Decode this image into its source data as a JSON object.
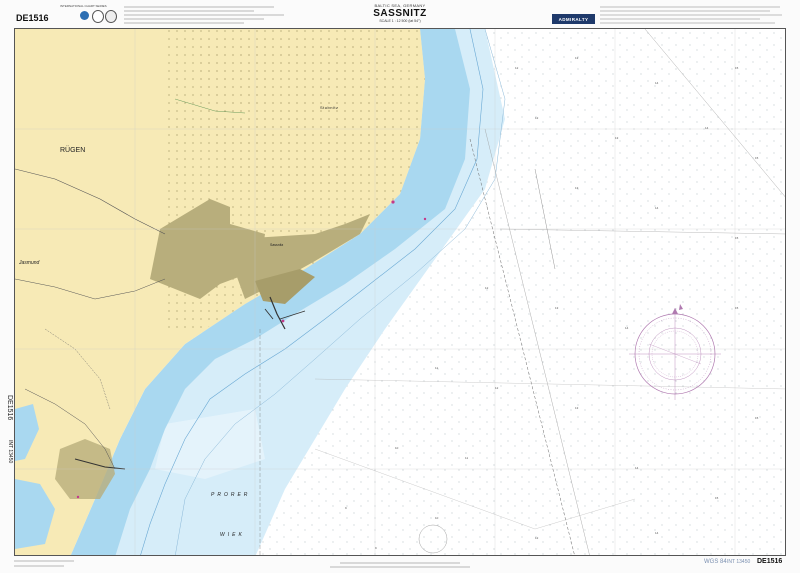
{
  "header": {
    "region": "BALTIC SEA, GERMANY",
    "title": "SASSNITZ",
    "scale": "SCALE 1 : 12 500 (lat 54°)",
    "chart_number_top": "DE1516",
    "admiralty": "ADMIRALTY",
    "intl_series": "INTERNATIONAL CHART SERIES"
  },
  "places": {
    "island": "RÜGEN",
    "region_west": "Jasmund",
    "town": "Sassnitz",
    "coast_north": "Stubnitz",
    "bay_word1": "PRORER",
    "bay_word2": "WIEK"
  },
  "side": {
    "chart_no_rot": "DE1516",
    "int_no_rot": "INT 13450"
  },
  "footer": {
    "datum": "WGS 84",
    "int_number": "INT 13450",
    "chart_number": "DE1516"
  },
  "colors": {
    "land": "#f7eab6",
    "urban": "#b8ae7c",
    "shallow": "#a9d8f0",
    "mid": "#d6edf9",
    "deep": "#ffffff",
    "brand": "#1f3a6b"
  }
}
